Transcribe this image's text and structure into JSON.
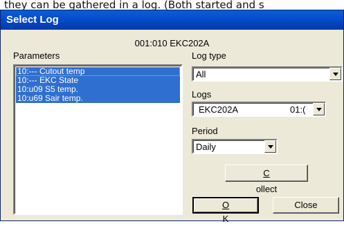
{
  "background_text": "they can be gathered in a log. (Both started and s",
  "dialog": {
    "title": "Select Log",
    "device": "001:010 EKC202A"
  },
  "parameters": {
    "label": "Parameters",
    "items": [
      "10:--- Cutout temp",
      "10:--- EKC State",
      "10:u09 S5 temp.",
      "10:u69 Sair temp."
    ]
  },
  "log_type": {
    "label": "Log type",
    "value": "All"
  },
  "logs": {
    "label": "Logs",
    "name": "EKC202A",
    "id": "01:("
  },
  "period": {
    "label": "Period",
    "value": "Daily"
  },
  "buttons": {
    "collect_first": "C",
    "collect_rest": "ollect",
    "ok_first": "O",
    "ok_rest": "K",
    "close": "Close"
  },
  "colors": {
    "titlebar": "#0348c4",
    "selection": "#2f6fcf",
    "dialog_bg": "#ece9d8"
  }
}
